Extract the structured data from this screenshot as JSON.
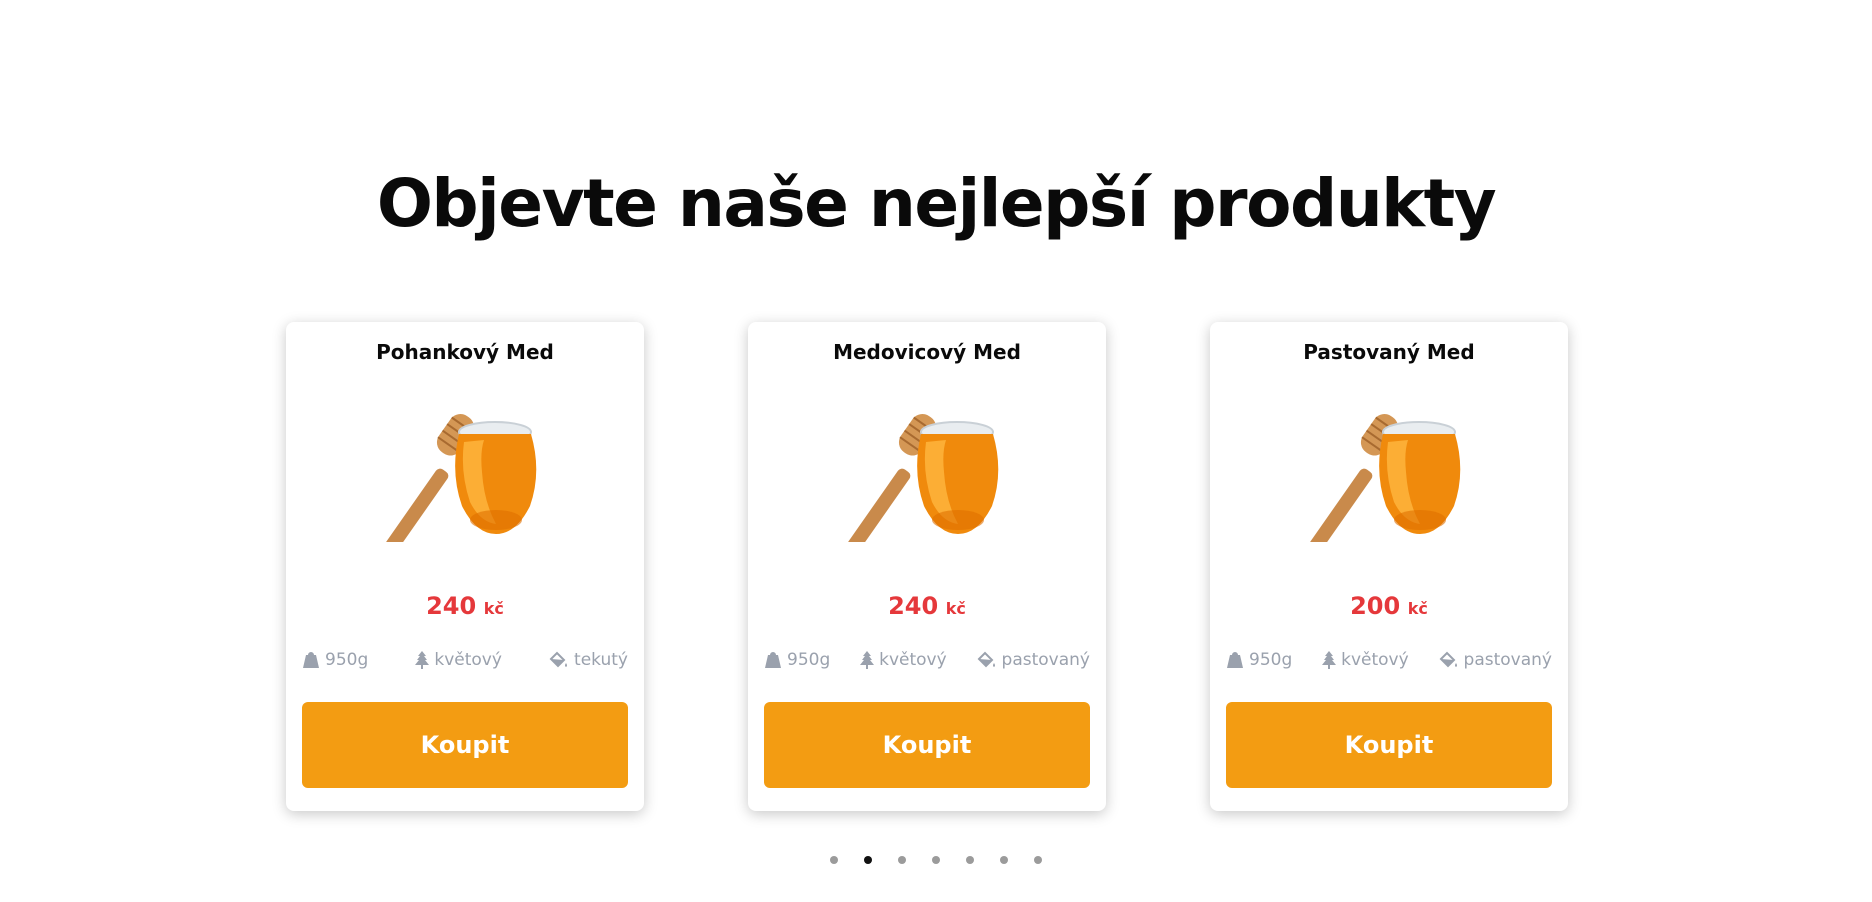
{
  "section": {
    "heading": "Objevte naše nejlepší produkty"
  },
  "products": [
    {
      "name": "Pohankový Med",
      "price": "240",
      "currency": "kč",
      "weight": "950g",
      "source": "květový",
      "consistency": "tekutý",
      "buy_label": "Koupit"
    },
    {
      "name": "Medovicový Med",
      "price": "240",
      "currency": "kč",
      "weight": "950g",
      "source": "květový",
      "consistency": "pastovaný",
      "buy_label": "Koupit"
    },
    {
      "name": "Pastovaný Med",
      "price": "200",
      "currency": "kč",
      "weight": "950g",
      "source": "květový",
      "consistency": "pastovaný",
      "buy_label": "Koupit"
    }
  ],
  "carousel": {
    "dot_count": 7,
    "active_index": 1
  },
  "icons": {
    "weight": "weight-icon",
    "source": "tree-icon",
    "consistency": "paint-bucket-icon",
    "product_image": "honey-jar-image"
  },
  "colors": {
    "price": "#e5383b",
    "button": "#f39c12",
    "spec_text": "#9aa1ad"
  }
}
